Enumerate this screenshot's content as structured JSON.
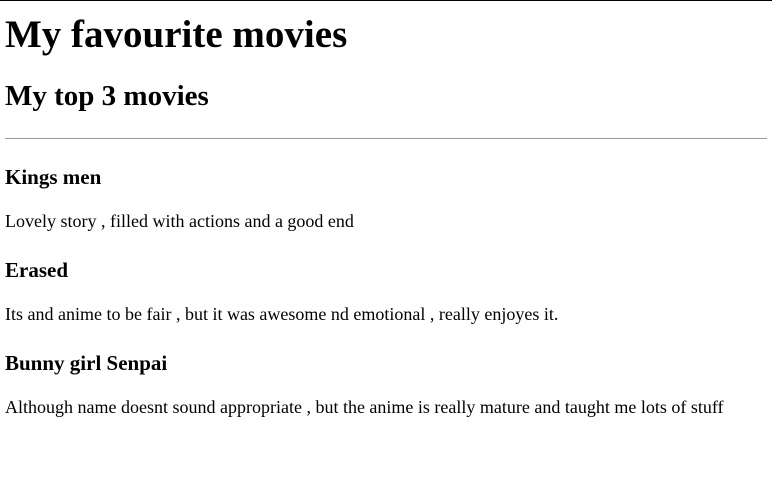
{
  "page": {
    "title": "My favourite movies",
    "subtitle": "My top 3 movies"
  },
  "movies": [
    {
      "title": "Kings men",
      "description": "Lovely story , filled with actions and a good end"
    },
    {
      "title": "Erased",
      "description": "Its and anime to be fair , but it was awesome nd emotional , really enjoyes it."
    },
    {
      "title": "Bunny girl Senpai",
      "description": "Although name doesnt sound appropriate , but the anime is really mature and taught me lots of stuff"
    }
  ]
}
